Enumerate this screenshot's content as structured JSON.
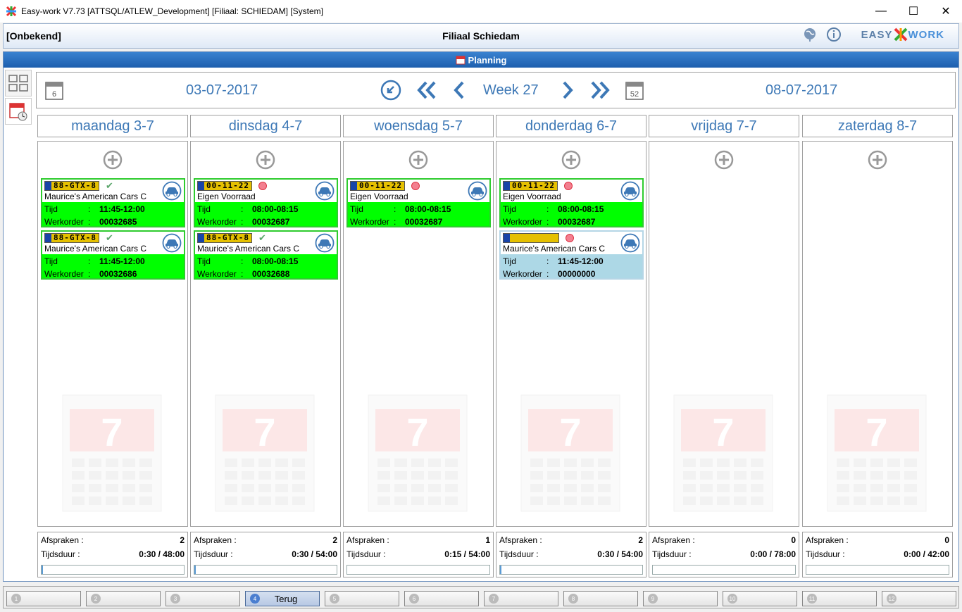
{
  "window": {
    "title": "Easy-work V7.73 [ATTSQL/ATLEW_Development] [Filiaal: SCHIEDAM] [System]",
    "min": "—",
    "max": "☐",
    "close": "✕"
  },
  "header": {
    "left": "[Onbekend]",
    "center": "Filiaal Schiedam",
    "logo_a": "EASY",
    "logo_b": "WORK"
  },
  "planning": {
    "title": "Planning"
  },
  "nav": {
    "start_date": "03-07-2017",
    "end_date": "08-07-2017",
    "week": "Week 27",
    "start_cal": "6",
    "end_cal": "52"
  },
  "days": [
    {
      "label": "maandag 3-7",
      "afspraken": "2",
      "tijdsduur": "0:30 / 48:00",
      "progress": 0.01,
      "appointments": [
        {
          "plate": "88-GTX-8",
          "status": "check",
          "customer": "Maurice's American Cars C",
          "tijd": "11:45-12:00",
          "werkorder": "00032685",
          "color": "green"
        },
        {
          "plate": "88-GTX-8",
          "status": "check",
          "customer": "Maurice's American Cars C",
          "tijd": "11:45-12:00",
          "werkorder": "00032686",
          "color": "green"
        }
      ]
    },
    {
      "label": "dinsdag 4-7",
      "afspraken": "2",
      "tijdsduur": "0:30 / 54:00",
      "progress": 0.01,
      "appointments": [
        {
          "plate": "00-11-22",
          "status": "dot",
          "customer": "Eigen Voorraad",
          "tijd": "08:00-08:15",
          "werkorder": "00032687",
          "color": "green"
        },
        {
          "plate": "88-GTX-8",
          "status": "check",
          "customer": "Maurice's American Cars C",
          "tijd": "08:00-08:15",
          "werkorder": "00032688",
          "color": "green"
        }
      ]
    },
    {
      "label": "woensdag 5-7",
      "afspraken": "1",
      "tijdsduur": "0:15 / 54:00",
      "progress": 0.0,
      "appointments": [
        {
          "plate": "00-11-22",
          "status": "dot",
          "customer": "Eigen Voorraad",
          "tijd": "08:00-08:15",
          "werkorder": "00032687",
          "color": "green"
        }
      ]
    },
    {
      "label": "donderdag 6-7",
      "afspraken": "2",
      "tijdsduur": "0:30 / 54:00",
      "progress": 0.01,
      "appointments": [
        {
          "plate": "00-11-22",
          "status": "dot",
          "customer": "Eigen Voorraad",
          "tijd": "08:00-08:15",
          "werkorder": "00032687",
          "color": "green"
        },
        {
          "plate": "",
          "status": "dot",
          "customer": "Maurice's American Cars C",
          "tijd": "11:45-12:00",
          "werkorder": "00000000",
          "color": "blue"
        }
      ]
    },
    {
      "label": "vrijdag 7-7",
      "afspraken": "0",
      "tijdsduur": "0:00 / 78:00",
      "progress": 0.0,
      "appointments": []
    },
    {
      "label": "zaterdag 8-7",
      "afspraken": "0",
      "tijdsduur": "0:00 / 42:00",
      "progress": 0.0,
      "appointments": []
    }
  ],
  "labels": {
    "tijd": "Tijd",
    "werkorder": "Werkorder",
    "afspraken": "Afspraken",
    "tijdsduur": "Tijdsduur",
    "colon": ":"
  },
  "watermark": {
    "day": "7"
  },
  "fkeys": [
    {
      "num": "1",
      "label": ""
    },
    {
      "num": "2",
      "label": ""
    },
    {
      "num": "3",
      "label": ""
    },
    {
      "num": "4",
      "label": "Terug"
    },
    {
      "num": "5",
      "label": ""
    },
    {
      "num": "6",
      "label": ""
    },
    {
      "num": "7",
      "label": ""
    },
    {
      "num": "8",
      "label": ""
    },
    {
      "num": "9",
      "label": ""
    },
    {
      "num": "10",
      "label": ""
    },
    {
      "num": "11",
      "label": ""
    },
    {
      "num": "12",
      "label": ""
    }
  ]
}
